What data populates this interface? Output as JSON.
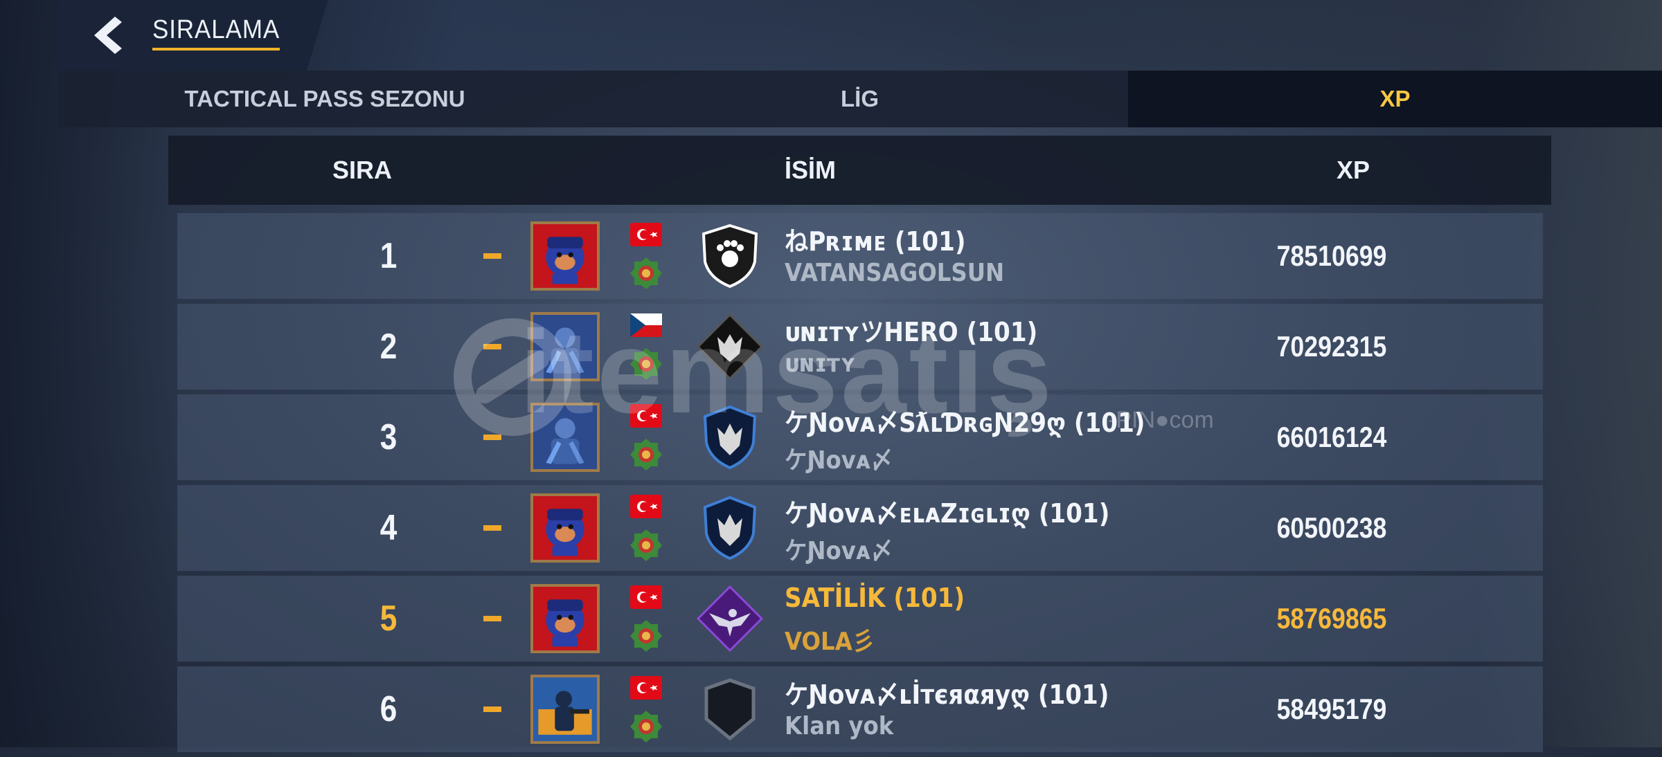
{
  "header": {
    "title": "SIRALAMA"
  },
  "tabs": [
    {
      "label": "TACTICAL PASS SEZONU",
      "active": false
    },
    {
      "label": "LİG",
      "active": false
    },
    {
      "label": "XP",
      "active": true
    }
  ],
  "table": {
    "columns": {
      "rank": "SIRA",
      "name": "İSİM",
      "xp": "XP"
    },
    "rows": [
      {
        "rank": "1",
        "name": "ねPʀɪᴍᴇ (101)",
        "clan": "VATANSAGOLSUN",
        "xp": "78510699",
        "flag": "turkey",
        "avatar": "red-monkey-avatar",
        "clan_icon": "paw-shield-icon",
        "highlight": false
      },
      {
        "rank": "2",
        "name": "ᴜɴɪᴛʏツHERO (101)",
        "clan": "ᴜɴɪᴛʏ",
        "xp": "70292315",
        "flag": "czech",
        "avatar": "blue-soldier-avatar",
        "clan_icon": "wolf-diamond-icon",
        "highlight": false
      },
      {
        "rank": "3",
        "name": "ケƝᴏᴠᴀ〆SƛʟƊʀɢƝ29ღ (101)",
        "clan": "ケƝᴏᴠᴀ〆",
        "xp": "66016124",
        "flag": "turkey",
        "avatar": "blue-soldier-avatar",
        "clan_icon": "wolf-shield-icon",
        "highlight": false
      },
      {
        "rank": "4",
        "name": "ケƝᴏᴠᴀ〆ᴇʟᴀZɪɢʟɪღ (101)",
        "clan": "ケƝᴏᴠᴀ〆",
        "xp": "60500238",
        "flag": "turkey",
        "avatar": "red-monkey-avatar",
        "clan_icon": "wolf-shield-icon",
        "highlight": false
      },
      {
        "rank": "5",
        "name": "SATİLİK (101)",
        "clan": "VOLA彡",
        "xp": "58769865",
        "flag": "turkey",
        "avatar": "red-monkey-avatar",
        "clan_icon": "eagle-diamond-icon",
        "highlight": true
      },
      {
        "rank": "6",
        "name": "ケƝᴏᴠᴀ〆ʟİᴛєяαяуღ (101)",
        "clan": "Klan yok",
        "xp": "58495179",
        "flag": "turkey",
        "avatar": "blue-commando-avatar",
        "clan_icon": "empty-shield-icon",
        "highlight": false
      }
    ]
  },
  "watermark": {
    "text": "itemsatış",
    "sub": "-PIN●com"
  },
  "colors": {
    "accent": "#f7c744",
    "highlight": "#f7b93a",
    "dash": "#f0a82a"
  }
}
